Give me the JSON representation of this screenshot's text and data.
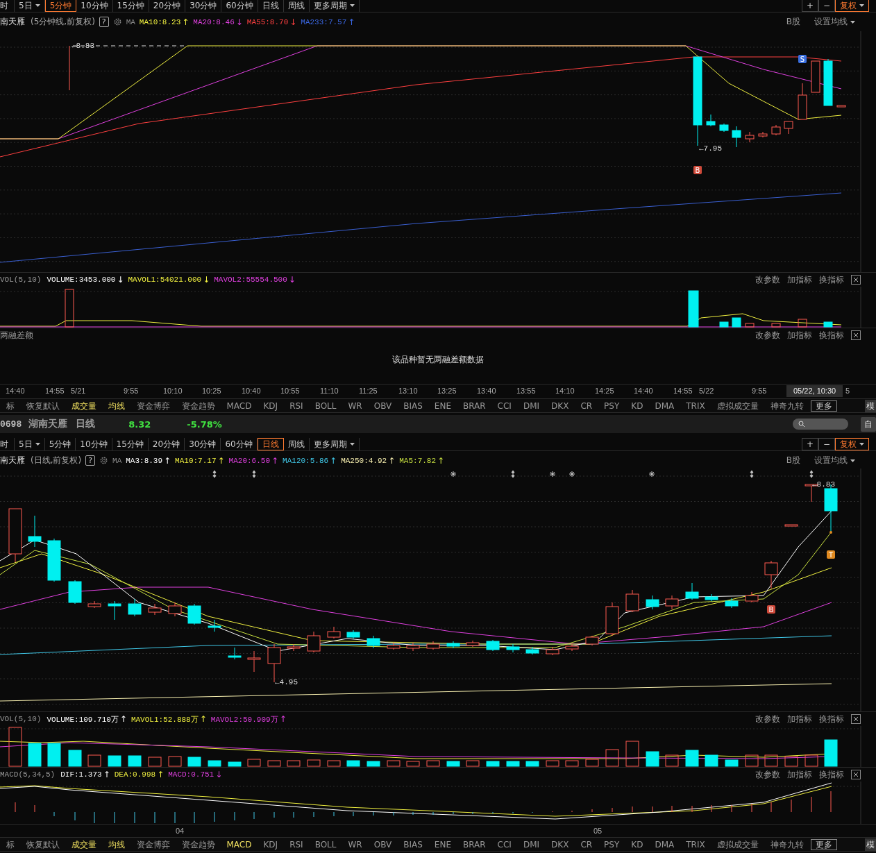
{
  "upper": {
    "period_tabs": [
      {
        "label": "时",
        "selected": false,
        "dropdown": false
      },
      {
        "label": "5日",
        "selected": false,
        "dropdown": true
      },
      {
        "label": "5分钟",
        "selected": true,
        "dropdown": false
      },
      {
        "label": "10分钟",
        "selected": false,
        "dropdown": false
      },
      {
        "label": "15分钟",
        "selected": false,
        "dropdown": false
      },
      {
        "label": "20分钟",
        "selected": false,
        "dropdown": false
      },
      {
        "label": "30分钟",
        "selected": false,
        "dropdown": false
      },
      {
        "label": "60分钟",
        "selected": false,
        "dropdown": false
      },
      {
        "label": "日线",
        "selected": false,
        "dropdown": false
      },
      {
        "label": "周线",
        "selected": false,
        "dropdown": false
      },
      {
        "label": "更多周期",
        "selected": false,
        "dropdown": true
      }
    ],
    "chart_controls": [
      {
        "label": "+",
        "active": false,
        "dropdown": false
      },
      {
        "label": "−",
        "active": false,
        "dropdown": false
      },
      {
        "label": "复权",
        "active": true,
        "dropdown": true
      }
    ],
    "title": {
      "stock_name": "南天雁",
      "chart_type": "(5分钟线,前复权)",
      "help": "?",
      "ma_label": "MA"
    },
    "moving_averages": [
      {
        "text": "MA10:8.23",
        "trend": "↑",
        "color": "#f0f040"
      },
      {
        "text": "MA20:8.46",
        "trend": "↓",
        "color": "#e040e0"
      },
      {
        "text": "MA55:8.70",
        "trend": "↓",
        "color": "#ff4040"
      },
      {
        "text": "MA233:7.57",
        "trend": "↑",
        "color": "#3a66e0"
      }
    ],
    "market": "B股",
    "ma_settings": "设置均线",
    "price_marks": [
      {
        "kind": "price",
        "text": "←8.83"
      },
      {
        "kind": "price",
        "text": "←7.95"
      },
      {
        "kind": "badge",
        "text": "S",
        "color": "#3a6fe0"
      },
      {
        "kind": "badge",
        "text": "B",
        "color": "#d04a3a"
      }
    ],
    "volume": {
      "title": "VOL(5,10)",
      "readings": [
        {
          "text": "VOLUME:3453.000",
          "trend": "↓",
          "color": "#ffffff"
        },
        {
          "text": "MAVOL1:54021.000",
          "trend": "↓",
          "color": "#f0f040"
        },
        {
          "text": "MAVOL2:55554.500",
          "trend": "↓",
          "color": "#e040e0"
        }
      ],
      "actions": [
        "改参数",
        "加指标",
        "换指标"
      ]
    },
    "margin_balance": {
      "title": "两融差额",
      "actions": [
        "改参数",
        "加指标",
        "换指标"
      ],
      "message": "该品种暂无两融差额数据"
    },
    "time_axis": [
      {
        "text": "14:40",
        "selected": false
      },
      {
        "text": "14:55",
        "selected": false
      },
      {
        "text": "5/21",
        "selected": false
      },
      {
        "text": "9:55",
        "selected": false
      },
      {
        "text": "10:10",
        "selected": false
      },
      {
        "text": "10:25",
        "selected": false
      },
      {
        "text": "10:40",
        "selected": false
      },
      {
        "text": "10:55",
        "selected": false
      },
      {
        "text": "11:10",
        "selected": false
      },
      {
        "text": "11:25",
        "selected": false
      },
      {
        "text": "13:10",
        "selected": false
      },
      {
        "text": "13:25",
        "selected": false
      },
      {
        "text": "13:40",
        "selected": false
      },
      {
        "text": "13:55",
        "selected": false
      },
      {
        "text": "14:10",
        "selected": false
      },
      {
        "text": "14:25",
        "selected": false
      },
      {
        "text": "14:40",
        "selected": false
      },
      {
        "text": "14:55",
        "selected": false
      },
      {
        "text": "5/22",
        "selected": false
      },
      {
        "text": "9:55",
        "selected": false
      },
      {
        "text": "05/22, 10:30",
        "selected": true
      },
      {
        "text": "5",
        "selected": false
      }
    ]
  },
  "upper_indicator_tabs": [
    {
      "label": "标",
      "kind": "tab",
      "selected": false
    },
    {
      "label": "恢复默认",
      "kind": "tab",
      "selected": false
    },
    {
      "label": "成交量",
      "kind": "tab",
      "selected": true
    },
    {
      "label": "均线",
      "kind": "tab",
      "selected": true
    },
    {
      "label": "资金博弈",
      "kind": "tab",
      "selected": false
    },
    {
      "label": "资金趋势",
      "kind": "tab",
      "selected": false
    },
    {
      "label": "MACD",
      "kind": "tab",
      "selected": false
    },
    {
      "label": "KDJ",
      "kind": "tab",
      "selected": false
    },
    {
      "label": "RSI",
      "kind": "tab",
      "selected": false
    },
    {
      "label": "BOLL",
      "kind": "tab",
      "selected": false
    },
    {
      "label": "WR",
      "kind": "tab",
      "selected": false
    },
    {
      "label": "OBV",
      "kind": "tab",
      "selected": false
    },
    {
      "label": "BIAS",
      "kind": "tab",
      "selected": false
    },
    {
      "label": "ENE",
      "kind": "tab",
      "selected": false
    },
    {
      "label": "BRAR",
      "kind": "tab",
      "selected": false
    },
    {
      "label": "CCI",
      "kind": "tab",
      "selected": false
    },
    {
      "label": "DMI",
      "kind": "tab",
      "selected": false
    },
    {
      "label": "DKX",
      "kind": "tab",
      "selected": false
    },
    {
      "label": "CR",
      "kind": "tab",
      "selected": false
    },
    {
      "label": "PSY",
      "kind": "tab",
      "selected": false
    },
    {
      "label": "KD",
      "kind": "tab",
      "selected": false
    },
    {
      "label": "DMA",
      "kind": "tab",
      "selected": false
    },
    {
      "label": "TRIX",
      "kind": "tab",
      "selected": false
    },
    {
      "label": "虚拟成交量",
      "kind": "tab",
      "selected": false
    },
    {
      "label": "神奇九转",
      "kind": "tab",
      "selected": false
    },
    {
      "label": "更多",
      "kind": "more",
      "selected": false
    },
    {
      "label": "模",
      "kind": "tab",
      "selected": false
    }
  ],
  "stock_header": {
    "code": "0698",
    "name": "湖南天雁",
    "period": "日线",
    "price": "8.32",
    "change": "-5.78%",
    "button": "自"
  },
  "lower": {
    "period_tabs": [
      {
        "label": "时",
        "selected": false,
        "dropdown": false
      },
      {
        "label": "5日",
        "selected": false,
        "dropdown": true
      },
      {
        "label": "5分钟",
        "selected": false,
        "dropdown": false
      },
      {
        "label": "10分钟",
        "selected": false,
        "dropdown": false
      },
      {
        "label": "15分钟",
        "selected": false,
        "dropdown": false
      },
      {
        "label": "20分钟",
        "selected": false,
        "dropdown": false
      },
      {
        "label": "30分钟",
        "selected": false,
        "dropdown": false
      },
      {
        "label": "60分钟",
        "selected": false,
        "dropdown": false
      },
      {
        "label": "日线",
        "selected": true,
        "dropdown": false
      },
      {
        "label": "周线",
        "selected": false,
        "dropdown": false
      },
      {
        "label": "更多周期",
        "selected": false,
        "dropdown": true
      }
    ],
    "chart_controls": [
      {
        "label": "+",
        "active": false,
        "dropdown": false
      },
      {
        "label": "−",
        "active": false,
        "dropdown": false
      },
      {
        "label": "复权",
        "active": true,
        "dropdown": true
      }
    ],
    "title": {
      "stock_name": "南天雁",
      "chart_type": "(日线,前复权)",
      "help": "?",
      "ma_label": "MA"
    },
    "moving_averages": [
      {
        "text": "MA3:8.39",
        "trend": "↑",
        "color": "#ffffff"
      },
      {
        "text": "MA10:7.17",
        "trend": "↑",
        "color": "#f0f040"
      },
      {
        "text": "MA20:6.50",
        "trend": "↑",
        "color": "#e040e0"
      },
      {
        "text": "MA120:5.86",
        "trend": "↑",
        "color": "#40c8e8"
      },
      {
        "text": "MA250:4.92",
        "trend": "↑",
        "color": "#f8f0b0"
      },
      {
        "text": "MA5:7.82",
        "trend": "↑",
        "color": "#c8e040"
      }
    ],
    "market": "B股",
    "ma_settings": "设置均线",
    "price_marks": [
      {
        "kind": "price",
        "text": "←8.83"
      },
      {
        "kind": "price",
        "text": "←4.95"
      },
      {
        "kind": "badge",
        "text": "T",
        "color": "#e08a20"
      },
      {
        "kind": "badge",
        "text": "B",
        "color": "#d04a3a"
      }
    ],
    "volume": {
      "title": "VOL(5,10)",
      "readings": [
        {
          "text": "VOLUME:109.710万",
          "trend": "↑",
          "color": "#ffffff"
        },
        {
          "text": "MAVOL1:52.888万",
          "trend": "↑",
          "color": "#f0f040"
        },
        {
          "text": "MAVOL2:50.909万",
          "trend": "↑",
          "color": "#e040e0"
        }
      ],
      "actions": [
        "改参数",
        "加指标",
        "换指标"
      ]
    },
    "macd": {
      "title": "MACD(5,34,5)",
      "readings": [
        {
          "text": "DIF:1.373",
          "trend": "↑",
          "color": "#ffffff"
        },
        {
          "text": "DEA:0.998",
          "trend": "↑",
          "color": "#f0f040"
        },
        {
          "text": "MACD:0.751",
          "trend": "↓",
          "color": "#e040e0"
        }
      ],
      "actions": [
        "改参数",
        "加指标",
        "换指标"
      ]
    },
    "time_axis": [
      {
        "text": "04",
        "selected": false
      },
      {
        "text": "05",
        "selected": false
      }
    ]
  },
  "lower_indicator_tabs": [
    {
      "label": "标",
      "kind": "tab",
      "selected": false
    },
    {
      "label": "恢复默认",
      "kind": "tab",
      "selected": false
    },
    {
      "label": "成交量",
      "kind": "tab",
      "selected": true
    },
    {
      "label": "均线",
      "kind": "tab",
      "selected": true
    },
    {
      "label": "资金博弈",
      "kind": "tab",
      "selected": false
    },
    {
      "label": "资金趋势",
      "kind": "tab",
      "selected": false
    },
    {
      "label": "MACD",
      "kind": "tab",
      "selected": true
    },
    {
      "label": "KDJ",
      "kind": "tab",
      "selected": false
    },
    {
      "label": "RSI",
      "kind": "tab",
      "selected": false
    },
    {
      "label": "BOLL",
      "kind": "tab",
      "selected": false
    },
    {
      "label": "WR",
      "kind": "tab",
      "selected": false
    },
    {
      "label": "OBV",
      "kind": "tab",
      "selected": false
    },
    {
      "label": "BIAS",
      "kind": "tab",
      "selected": false
    },
    {
      "label": "ENE",
      "kind": "tab",
      "selected": false
    },
    {
      "label": "BRAR",
      "kind": "tab",
      "selected": false
    },
    {
      "label": "CCI",
      "kind": "tab",
      "selected": false
    },
    {
      "label": "DMI",
      "kind": "tab",
      "selected": false
    },
    {
      "label": "DKX",
      "kind": "tab",
      "selected": false
    },
    {
      "label": "CR",
      "kind": "tab",
      "selected": false
    },
    {
      "label": "PSY",
      "kind": "tab",
      "selected": false
    },
    {
      "label": "KD",
      "kind": "tab",
      "selected": false
    },
    {
      "label": "DMA",
      "kind": "tab",
      "selected": false
    },
    {
      "label": "TRIX",
      "kind": "tab",
      "selected": false
    },
    {
      "label": "虚拟成交量",
      "kind": "tab",
      "selected": false
    },
    {
      "label": "神奇九转",
      "kind": "tab",
      "selected": false
    },
    {
      "label": "更多",
      "kind": "more",
      "selected": false
    },
    {
      "label": "模",
      "kind": "tab",
      "selected": false
    }
  ]
}
